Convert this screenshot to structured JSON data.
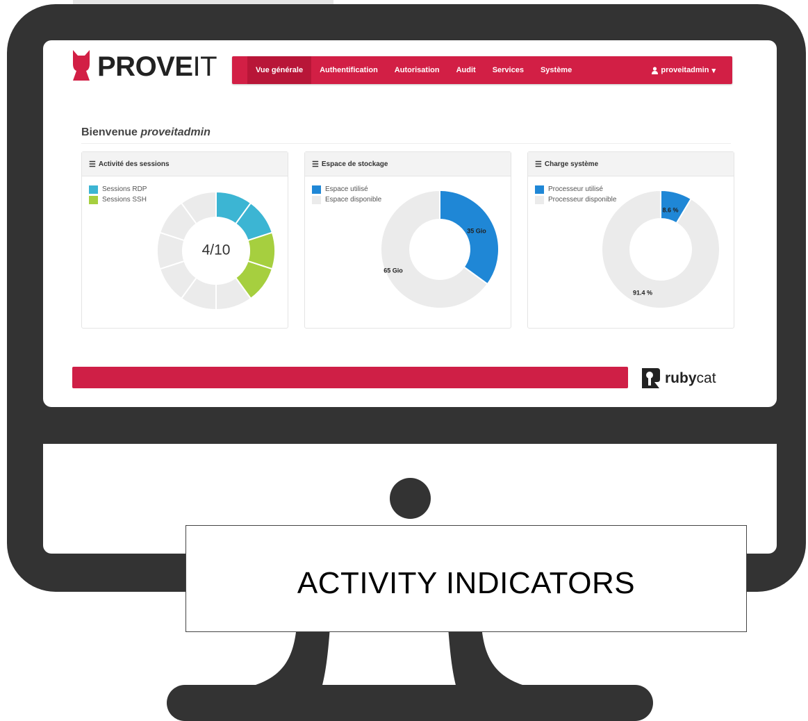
{
  "brand": {
    "logo_bold": "PROVE",
    "logo_light": "IT"
  },
  "nav": {
    "items": [
      {
        "label": "Vue générale",
        "active": true
      },
      {
        "label": "Authentification"
      },
      {
        "label": "Autorisation"
      },
      {
        "label": "Audit"
      },
      {
        "label": "Services"
      },
      {
        "label": "Système"
      }
    ],
    "user": "proveitadmin",
    "user_icon": "user-icon",
    "caret_icon": "caret-down-icon"
  },
  "welcome": {
    "prefix": "Bienvenue",
    "username": "proveitadmin"
  },
  "panels": [
    {
      "title": "Activité des sessions",
      "icon": "list-icon",
      "legend": [
        {
          "label": "Sessions RDP",
          "color": "#3cb5d3"
        },
        {
          "label": "Sessions SSH",
          "color": "#a6cf3f"
        }
      ],
      "center_label": "4/10",
      "total": 10,
      "rdp": 2,
      "ssh": 2
    },
    {
      "title": "Espace de stockage",
      "icon": "list-icon",
      "legend": [
        {
          "label": "Espace utilisé",
          "color": "#1f87d6"
        },
        {
          "label": "Espace disponible",
          "color": "#ebebeb"
        }
      ],
      "used_label": "35 Gio",
      "free_label": "65 Gio",
      "used_fraction": 0.35
    },
    {
      "title": "Charge système",
      "icon": "list-icon",
      "legend": [
        {
          "label": "Processeur utilisé",
          "color": "#1f87d6"
        },
        {
          "label": "Processeur disponible",
          "color": "#ebebeb"
        }
      ],
      "used_label": "8.6 %",
      "free_label": "91.4 %",
      "used_fraction": 0.086
    }
  ],
  "footer": {
    "brand_bold": "ruby",
    "brand_light": "cat",
    "accent": "#cf1f46"
  },
  "caption": "ACTIVITY INDICATORS",
  "colors": {
    "frame": "#333333",
    "accent": "#d21f45",
    "blue": "#1f87d6",
    "empty": "#ebebeb"
  }
}
